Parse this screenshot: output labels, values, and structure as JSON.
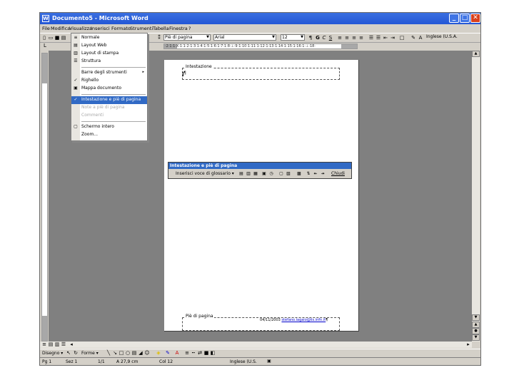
{
  "window": {
    "title": "Documento5 - Microsoft Word",
    "icon": "word-icon",
    "controls": [
      "minimize-icon",
      "maximize-icon",
      "close-icon"
    ]
  },
  "menubar": [
    "File",
    "Modifica",
    "Visualizza",
    "Inserisci",
    "Formato",
    "Strumenti",
    "Tabella",
    "Finestra",
    "?"
  ],
  "toolbar": {
    "style_value": "Piè di pagina",
    "font_value": "Arial",
    "size_value": "12",
    "language": "Inglese (U.S.A."
  },
  "ruler": {
    "ticks": "·2·1·1·X·1·1·2·1·3·1·4·1·5·1·6·1·7·1·8·⊥·9·1·10·1·11·1·12·1·13·1·14·1·15·1·16·1·⊥·18·"
  },
  "view_menu": {
    "items": [
      {
        "label": "Normale",
        "icon": "normal-view-icon"
      },
      {
        "label": "Layout Web",
        "icon": "web-layout-icon"
      },
      {
        "label": "Layout di stampa",
        "icon": "print-layout-icon"
      },
      {
        "label": "Struttura",
        "icon": "outline-icon"
      },
      {
        "label": "Barre degli strumenti",
        "icon": "",
        "submenu": "▸"
      },
      {
        "label": "Righello",
        "icon": "check-icon"
      },
      {
        "label": "Mappa documento",
        "icon": "document-map-icon"
      },
      {
        "label": "Intestazione e piè di pagina",
        "icon": "check-icon"
      },
      {
        "label": "Note a piè di pagina",
        "icon": ""
      },
      {
        "label": "Commenti",
        "icon": ""
      },
      {
        "label": "Schermo intero",
        "icon": "full-screen-icon"
      },
      {
        "label": "Zoom...",
        "icon": ""
      }
    ]
  },
  "page": {
    "header_label": "Intestazione",
    "header_marker": "¶",
    "footer_label": "Piè di pagina",
    "footer_date": "04/11/2003",
    "footer_email": "stefano.iagaio@iis.infn.it",
    "footer_marker": "¶"
  },
  "hf_toolbar": {
    "title": "Intestazione e piè di pagina",
    "insert_label": "Inserisci voce di glossario ▾",
    "close_label": "Chiudi"
  },
  "drawbar": {
    "draw_label": "Disegno ▾",
    "shapes_label": "Forme ▾"
  },
  "status": {
    "page": "Pg 1",
    "section": "Sez 1",
    "pages": "1/1",
    "at": "A 27,9 cm",
    "col": "Col 12",
    "lang": "Inglese (U.S."
  }
}
